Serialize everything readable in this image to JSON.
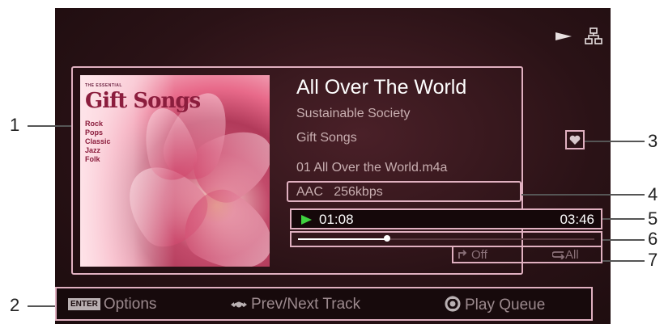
{
  "track": {
    "title": "All Over The World",
    "artist": "Sustainable Society",
    "album": "Gift Songs",
    "filename": "01 All Over the World.m4a",
    "codec": "AAC   256kbps"
  },
  "art": {
    "small_title": "THE ESSENTIAL",
    "logo": "Gift Songs",
    "genres": [
      "Rock",
      "Pops",
      "Classic",
      "Jazz",
      "Folk"
    ]
  },
  "playback": {
    "elapsed": "01:08",
    "total": "03:46",
    "progress_fraction": 0.3,
    "shuffle_label": "Off",
    "repeat_label": "All"
  },
  "bottom_bar": {
    "enter_key": "ENTER",
    "options_label": "Options",
    "prev_next_label": "Prev/Next Track",
    "play_queue_label": "Play Queue"
  },
  "callouts": [
    "1",
    "2",
    "3",
    "4",
    "5",
    "6",
    "7"
  ],
  "icons": {
    "status": [
      "play-status-icon",
      "network-icon"
    ],
    "favorite": "heart-icon"
  },
  "colors": {
    "highlight_border": "#e0b0c0",
    "play_indicator": "#3fd23f"
  }
}
